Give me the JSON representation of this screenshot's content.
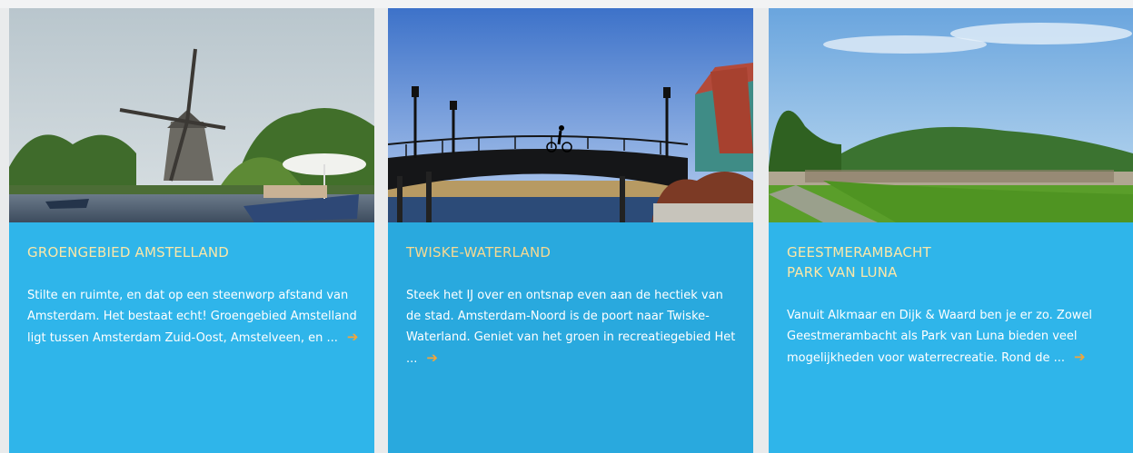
{
  "cards": [
    {
      "title": "GROENGEBIED AMSTELLAND",
      "text": "Stilte en ruimte, en dat op een steenworp afstand van Amsterdam. Het bestaat echt! Groengebied Amstelland ligt tussen Amsterdam Zuid-Oost, Amstelveen, en ...",
      "more_icon": "arrow-right-icon",
      "image_alt": "windmill-river-boat-photo"
    },
    {
      "title": "TWISKE-WATERLAND",
      "text": "Steek het IJ over en ontsnap even aan de hectiek van de stad. Amsterdam-Noord is de poort naar Twiske-Waterland. Geniet van het groen in recreatiegebied Het ...",
      "more_icon": "arrow-right-icon",
      "image_alt": "bridge-cyclist-canal-photo"
    },
    {
      "title": "GEESTMERAMBACHT\nPARK VAN LUNA",
      "text": "Vanuit Alkmaar en Dijk & Waard ben je er zo. Zowel Geestmerambacht als Park van Luna bieden veel mogelijkheden voor waterrecreatie. Rond de ...",
      "more_icon": "arrow-right-icon",
      "image_alt": "beach-park-crowd-photo"
    }
  ],
  "colors": {
    "card_bg": "#2fb5ea",
    "title": "#fbe7a8",
    "arrow": "#f3a53a"
  }
}
